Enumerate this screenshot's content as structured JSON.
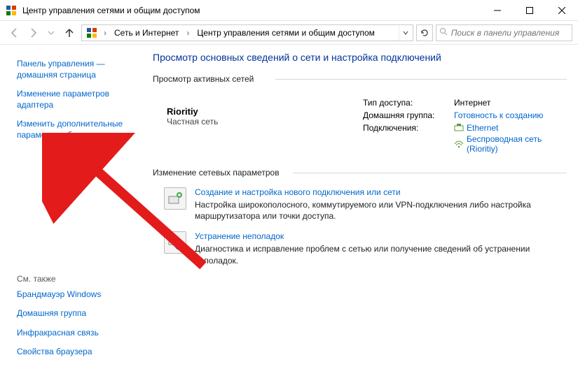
{
  "window": {
    "title": "Центр управления сетями и общим доступом"
  },
  "breadcrumb": {
    "level1": "Сеть и Интернет",
    "level2": "Центр управления сетями и общим доступом"
  },
  "search": {
    "placeholder": "Поиск в панели управления"
  },
  "sidebar": {
    "home": "Панель управления — домашняя страница",
    "links": [
      "Изменение параметров адаптера",
      "Изменить дополнительные параметры общего доступа"
    ],
    "see_also_header": "См. также",
    "see_also": [
      "Брандмауэр Windows",
      "Домашняя группа",
      "Инфракрасная связь",
      "Свойства браузера"
    ]
  },
  "main": {
    "page_title": "Просмотр основных сведений о сети и настройка подключений",
    "active_nets_header": "Просмотр активных сетей",
    "network": {
      "name": "Rioritiy",
      "type": "Частная сеть",
      "access_label": "Тип доступа:",
      "access_value": "Интернет",
      "homegroup_label": "Домашняя группа:",
      "homegroup_value": "Готовность к созданию",
      "connections_label": "Подключения:",
      "conn1": "Ethernet",
      "conn2": "Беспроводная сеть (Rioritiy)"
    },
    "change_header": "Изменение сетевых параметров",
    "task1": {
      "title": "Создание и настройка нового подключения или сети",
      "desc": "Настройка широкополосного, коммутируемого или VPN-подключения либо настройка маршрутизатора или точки доступа."
    },
    "task2": {
      "title": "Устранение неполадок",
      "desc": "Диагностика и исправление проблем с сетью или получение сведений об устранении неполадок."
    }
  }
}
